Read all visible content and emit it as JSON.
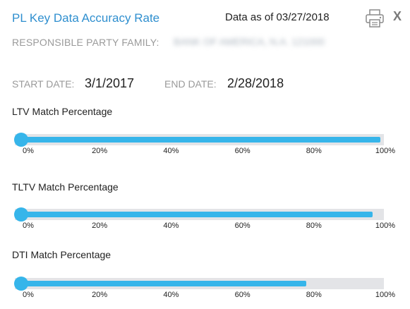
{
  "header": {
    "title": "PL Key Data Accuracy Rate",
    "data_as_of": "Data as of 03/27/2018",
    "print_icon": "printer-icon",
    "close_label": "X"
  },
  "responsible_party": {
    "label": "RESPONSIBLE PARTY FAMILY:",
    "value": "BANK OF AMERICA, N.A. 121000"
  },
  "dates": {
    "start_label": "START DATE:",
    "start_value": "3/1/2017",
    "end_label": "END DATE:",
    "end_value": "2/28/2018"
  },
  "tick_labels": [
    "0%",
    "20%",
    "40%",
    "60%",
    "80%",
    "100%"
  ],
  "metrics": [
    {
      "title": "LTV Match Percentage",
      "value_percent": 99
    },
    {
      "title": "TLTV Match Percentage",
      "value_percent": 97
    },
    {
      "title": "DTI Match Percentage",
      "value_percent": 79
    }
  ],
  "colors": {
    "accent": "#36b5ea",
    "track": "#e3e4e7",
    "title": "#2f8fcf"
  }
}
